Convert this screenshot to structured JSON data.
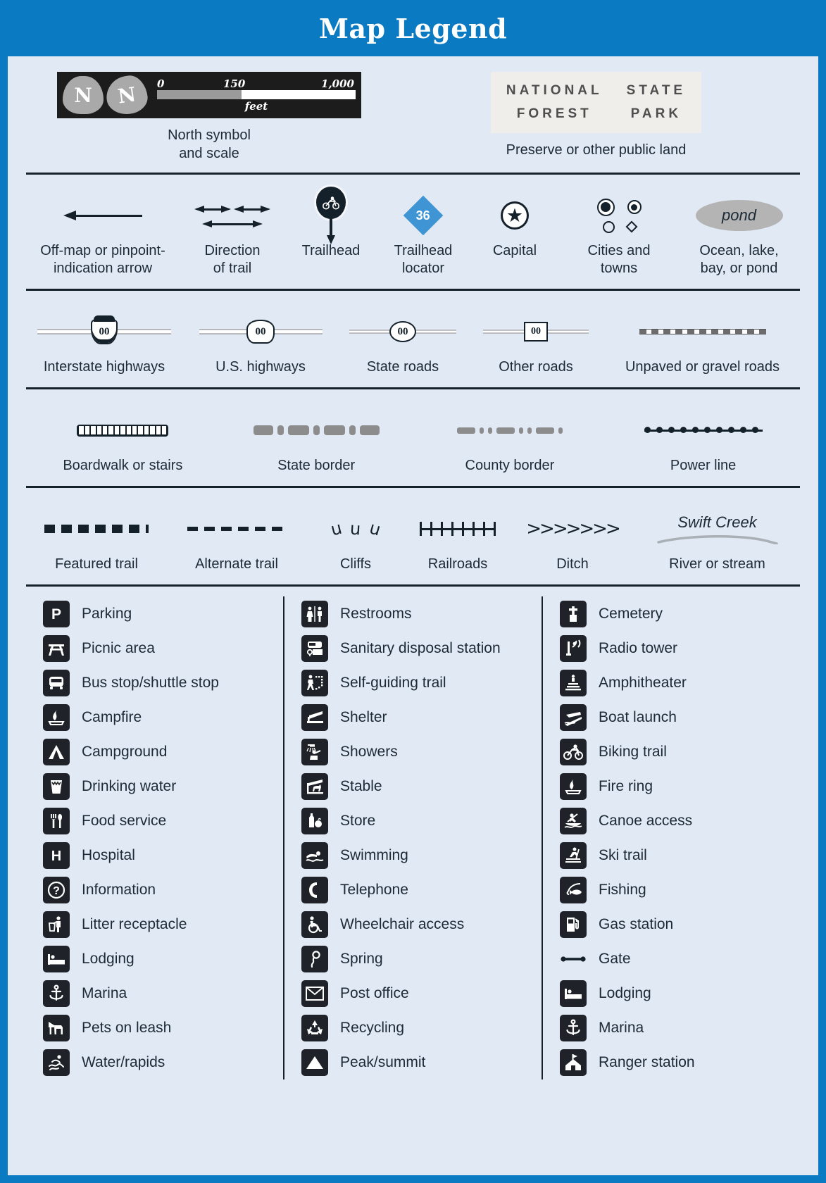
{
  "header": {
    "title": "Map Legend"
  },
  "scale": {
    "north_letter": "N",
    "ticks": [
      "0",
      "150",
      "1,000"
    ],
    "unit": "feet",
    "caption": "North symbol\nand scale"
  },
  "preserve": {
    "line1_left": "NATIONAL",
    "line2_left": "FOREST",
    "line1_right": "STATE",
    "line2_right": "PARK",
    "caption": "Preserve or other public land"
  },
  "captions": {
    "north": "North symbol",
    "north2": "and scale",
    "preserve": "Preserve or other public land"
  },
  "symbols": [
    {
      "id": "offmap-arrow",
      "label": "Off-map or pinpoint-",
      "label2": "indication arrow"
    },
    {
      "id": "direction-of-trail",
      "label": "Direction",
      "label2": "of trail"
    },
    {
      "id": "trailhead",
      "label": "Trailhead",
      "label2": ""
    },
    {
      "id": "trailhead-locator",
      "label": "Trailhead",
      "label2": "locator",
      "value": "36",
      "color": "#3f94d3"
    },
    {
      "id": "capital",
      "label": "Capital",
      "label2": ""
    },
    {
      "id": "cities-and-towns",
      "label": "Cities and",
      "label2": "towns"
    },
    {
      "id": "ocean-lake-bay-pond",
      "label": "Ocean, lake,",
      "label2": "bay, or pond",
      "water_label": "pond"
    }
  ],
  "roads": [
    {
      "id": "interstate-highways",
      "label": "Interstate highways",
      "shield": "00"
    },
    {
      "id": "us-highways",
      "label": "U.S. highways",
      "shield": "00"
    },
    {
      "id": "state-roads",
      "label": "State roads",
      "shield": "00"
    },
    {
      "id": "other-roads",
      "label": "Other roads",
      "shield": "00"
    },
    {
      "id": "unpaved-gravel-roads",
      "label": "Unpaved or gravel roads",
      "shield": ""
    }
  ],
  "borders": [
    {
      "id": "boardwalk-or-stairs",
      "label": "Boardwalk or stairs"
    },
    {
      "id": "state-border",
      "label": "State border"
    },
    {
      "id": "county-border",
      "label": "County border"
    },
    {
      "id": "power-line",
      "label": "Power line"
    }
  ],
  "trails": [
    {
      "id": "featured-trail",
      "label": "Featured trail"
    },
    {
      "id": "alternate-trail",
      "label": "Alternate trail"
    },
    {
      "id": "cliffs",
      "label": "Cliffs"
    },
    {
      "id": "railroads",
      "label": "Railroads"
    },
    {
      "id": "ditch",
      "label": "Ditch"
    },
    {
      "id": "river-or-stream",
      "label": "River or stream",
      "stream_name": "Swift Creek"
    }
  ],
  "icon_columns": [
    [
      {
        "icon": "parking-icon",
        "label": "Parking"
      },
      {
        "icon": "picnic-icon",
        "label": "Picnic area"
      },
      {
        "icon": "bus-icon",
        "label": "Bus stop/shuttle stop"
      },
      {
        "icon": "campfire-icon",
        "label": "Campfire"
      },
      {
        "icon": "tent-icon",
        "label": "Campground"
      },
      {
        "icon": "drinking-water-icon",
        "label": "Drinking water"
      },
      {
        "icon": "food-service-icon",
        "label": "Food service"
      },
      {
        "icon": "hospital-icon",
        "label": "Hospital"
      },
      {
        "icon": "information-icon",
        "label": "Information"
      },
      {
        "icon": "litter-icon",
        "label": "Litter receptacle"
      },
      {
        "icon": "lodging-icon",
        "label": "Lodging"
      },
      {
        "icon": "marina-icon",
        "label": "Marina"
      },
      {
        "icon": "pets-on-leash-icon",
        "label": "Pets on leash"
      },
      {
        "icon": "water-rapids-icon",
        "label": "Water/rapids"
      }
    ],
    [
      {
        "icon": "restrooms-icon",
        "label": "Restrooms"
      },
      {
        "icon": "sanitary-disposal-icon",
        "label": "Sanitary disposal station"
      },
      {
        "icon": "self-guiding-trail-icon",
        "label": "Self-guiding trail"
      },
      {
        "icon": "shelter-icon",
        "label": "Shelter"
      },
      {
        "icon": "showers-icon",
        "label": "Showers"
      },
      {
        "icon": "stable-icon",
        "label": "Stable"
      },
      {
        "icon": "store-icon",
        "label": "Store"
      },
      {
        "icon": "swimming-icon",
        "label": "Swimming"
      },
      {
        "icon": "telephone-icon",
        "label": "Telephone"
      },
      {
        "icon": "wheelchair-icon",
        "label": "Wheelchair access"
      },
      {
        "icon": "spring-icon",
        "label": "Spring"
      },
      {
        "icon": "post-office-icon",
        "label": "Post office"
      },
      {
        "icon": "recycling-icon",
        "label": "Recycling"
      },
      {
        "icon": "peak-summit-icon",
        "label": "Peak/summit"
      }
    ],
    [
      {
        "icon": "cemetery-icon",
        "label": "Cemetery"
      },
      {
        "icon": "radio-tower-icon",
        "label": "Radio tower"
      },
      {
        "icon": "amphitheater-icon",
        "label": "Amphitheater"
      },
      {
        "icon": "boat-launch-icon",
        "label": "Boat launch"
      },
      {
        "icon": "biking-trail-icon",
        "label": "Biking trail"
      },
      {
        "icon": "fire-ring-icon",
        "label": "Fire ring"
      },
      {
        "icon": "canoe-access-icon",
        "label": "Canoe access"
      },
      {
        "icon": "ski-trail-icon",
        "label": "Ski trail"
      },
      {
        "icon": "fishing-icon",
        "label": "Fishing"
      },
      {
        "icon": "gas-station-icon",
        "label": "Gas station"
      },
      {
        "icon": "gate-icon",
        "label": "Gate"
      },
      {
        "icon": "lodging-icon",
        "label": "Lodging"
      },
      {
        "icon": "marina-icon",
        "label": "Marina"
      },
      {
        "icon": "ranger-station-icon",
        "label": "Ranger station"
      }
    ]
  ],
  "colors": {
    "brand_blue": "#0a7ac2",
    "panel_bg": "#e1e9f5",
    "ink": "#14202a",
    "icon_bg": "#1f2329",
    "locator_blue": "#3f94d3",
    "water_gray": "#b4b4b4"
  }
}
